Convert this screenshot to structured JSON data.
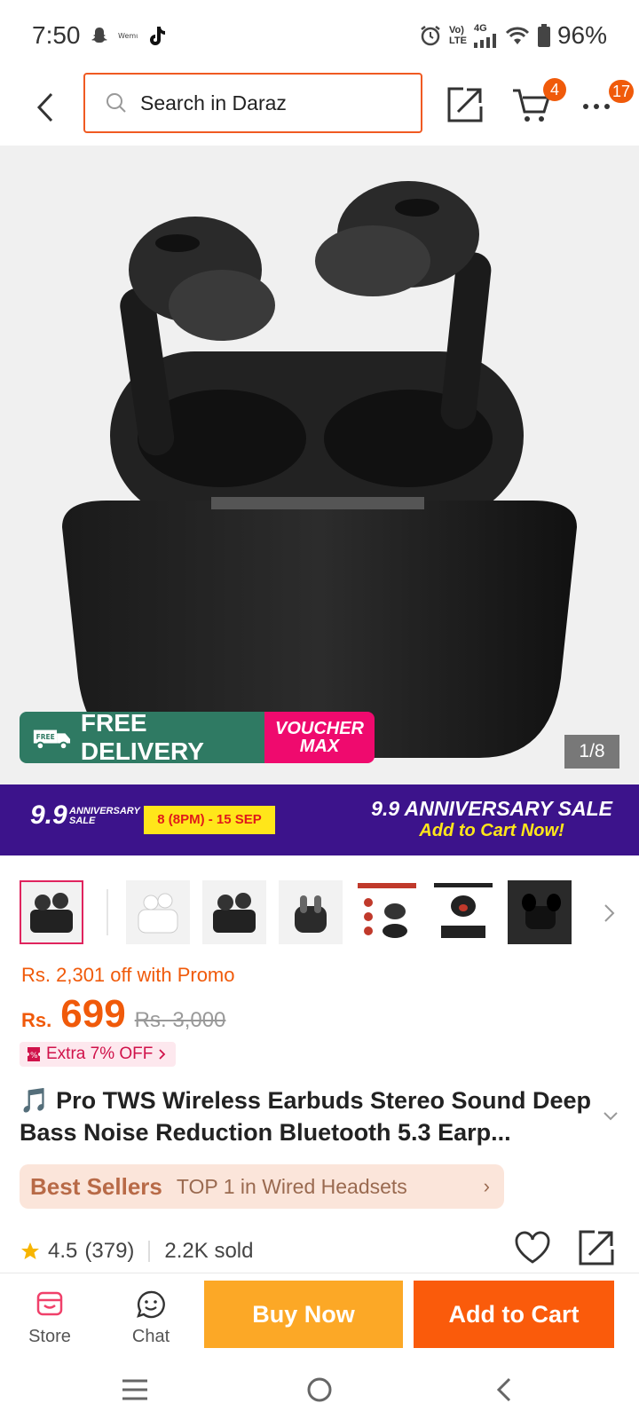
{
  "status_bar": {
    "time": "7:50",
    "network_label_top": "Vo)",
    "network_label_bottom": "LTE",
    "network_gen": "4G",
    "battery": "96%"
  },
  "header": {
    "search_placeholder": "Search in Daraz",
    "cart_count": "4",
    "more_count": "17"
  },
  "hero": {
    "image_counter": "1/8",
    "free_label": "FREE",
    "free_delivery_label": "FREE DELIVERY",
    "voucher_line1": "VOUCHER",
    "voucher_line2": "MAX"
  },
  "sale_banner": {
    "left_big": "9.9",
    "left_small_line1": "ANNIVERSARY",
    "left_small_line2": "SALE",
    "date": "8 (8PM) - 15 SEP",
    "title": "9.9 ANNIVERSARY SALE",
    "cta": "Add to Cart Now!"
  },
  "product": {
    "promo": "Rs. 2,301 off with Promo",
    "currency": "Rs.",
    "price": "699",
    "old_price": "Rs. 3,000",
    "extra_off": "Extra 7% OFF",
    "title": "🎵 Pro TWS Wireless Earbuds Stereo Sound Deep Bass Noise Reduction Bluetooth 5.3 Earp...",
    "best_sellers_brand": "Best Sellers",
    "best_sellers_text": "TOP 1 in Wired Headsets",
    "rating": "4.5",
    "reviews": "(379)",
    "sold": "2.2K sold"
  },
  "action_bar": {
    "store_label": "Store",
    "chat_label": "Chat",
    "buy_now": "Buy Now",
    "add_to_cart": "Add to Cart"
  },
  "colors": {
    "accent": "#f05a0a",
    "buy_now": "#fca826",
    "add_to_cart": "#fa5b0b",
    "banner": "#3c138b"
  }
}
